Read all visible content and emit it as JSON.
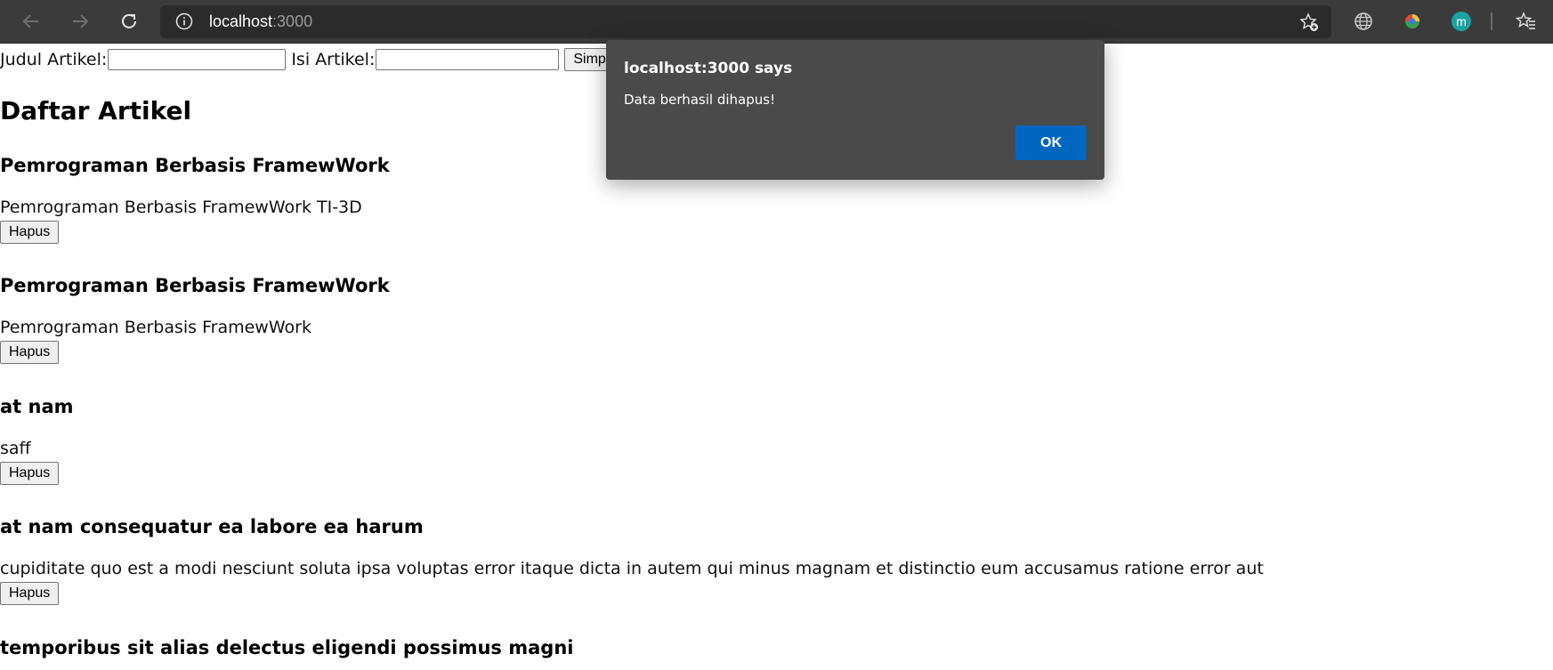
{
  "browser": {
    "url_host": "localhost",
    "url_port": ":3000",
    "icons": [
      "back-arrow-icon",
      "forward-arrow-icon",
      "reload-icon",
      "info-icon",
      "add-favorite-icon",
      "globe-icon",
      "extension-icon",
      "profile-icon",
      "favorites-icon"
    ],
    "profile_initial": "m",
    "profile_color": "#1aa3a3"
  },
  "form": {
    "title_label": "Judul Artikel:",
    "title_value": "",
    "content_label": "Isi Artikel:",
    "content_value": "",
    "save_label": "Simpan"
  },
  "heading": "Daftar Artikel",
  "articles": [
    {
      "title": "Pemrograman Berbasis FramewWork",
      "body": "Pemrograman Berbasis FramewWork TI-3D",
      "delete_label": "Hapus"
    },
    {
      "title": "Pemrograman Berbasis FramewWork",
      "body": "Pemrograman Berbasis FramewWork",
      "delete_label": "Hapus"
    },
    {
      "title": "at nam",
      "body": "saff",
      "delete_label": "Hapus"
    },
    {
      "title": "at nam consequatur ea labore ea harum",
      "body": "cupiditate quo est a modi nesciunt soluta ipsa voluptas error itaque dicta in autem qui minus magnam et distinctio eum accusamus ratione error aut",
      "delete_label": "Hapus"
    },
    {
      "title": "temporibus sit alias delectus eligendi possimus magni"
    }
  ],
  "dialog": {
    "title": "localhost:3000 says",
    "message": "Data berhasil dihapus!",
    "ok_label": "OK",
    "ok_color": "#0067c0"
  }
}
